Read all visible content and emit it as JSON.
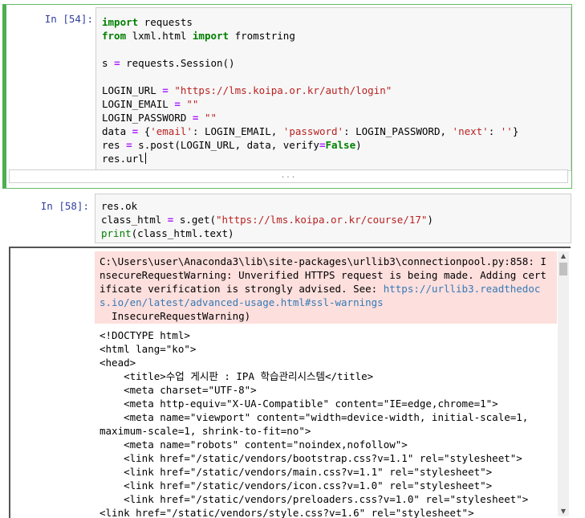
{
  "cell1": {
    "prompt": "In [54]:",
    "lines": [
      [
        "import",
        " requests"
      ],
      [
        "from",
        " lxml.html ",
        "import",
        " fromstring"
      ],
      [
        ""
      ],
      [
        "s ",
        "=",
        " requests.Session()"
      ],
      [
        ""
      ],
      [
        "LOGIN_URL ",
        "=",
        " ",
        "\"https://lms.koipa.or.kr/auth/login\""
      ],
      [
        "LOGIN_EMAIL ",
        "=",
        " ",
        "\"\""
      ],
      [
        "LOGIN_PASSWORD ",
        "=",
        " ",
        "\"\""
      ],
      [
        "data ",
        "=",
        " {",
        "'email'",
        ": LOGIN_EMAIL, ",
        "'password'",
        ": LOGIN_PASSWORD, ",
        "'next'",
        ": ",
        "''",
        "}"
      ],
      [
        "res ",
        "=",
        " s.post(LOGIN_URL, data, verify",
        "=",
        "False",
        ")"
      ],
      [
        "res.url"
      ]
    ],
    "collapsed_output": "..."
  },
  "cell2": {
    "prompt": "In [58]:",
    "line1": "res.ok",
    "line2_a": "class_html ",
    "line2_op": "=",
    "line2_b": " s.get(",
    "line2_str": "\"https://lms.koipa.or.kr/course/17\"",
    "line2_c": ")",
    "line3_fn": "print",
    "line3_b": "(class_html.text)"
  },
  "stderr": {
    "text_before_link": "C:\\Users\\user\\Anaconda3\\lib\\site-packages\\urllib3\\connectionpool.py:858: InsecureRequestWarning: Unverified HTTPS request is being made. Adding certificate verification is strongly advised. See: ",
    "link": "https://urllib3.readthedocs.io/en/latest/advanced-usage.html#ssl-warnings",
    "last_line": "  InsecureRequestWarning)"
  },
  "stdout": {
    "lines": [
      "<!DOCTYPE html>",
      "<html lang=\"ko\">",
      "<head>",
      "    <title>수업 게시판 : IPA 학습관리시스템</title>",
      "    <meta charset=\"UTF-8\">",
      "    <meta http-equiv=\"X-UA-Compatible\" content=\"IE=edge,chrome=1\">",
      "    <meta name=\"viewport\" content=\"width=device-width, initial-scale=1, maximum-scale=1, shrink-to-fit=no\">",
      "    <meta name=\"robots\" content=\"noindex,nofollow\">",
      "    <link href=\"/static/vendors/bootstrap.css?v=1.1\" rel=\"stylesheet\">",
      "    <link href=\"/static/vendors/main.css?v=1.1\" rel=\"stylesheet\">",
      "    <link href=\"/static/vendors/icon.css?v=1.0\" rel=\"stylesheet\">",
      "    <link href=\"/static/vendors/preloaders.css?v=1.0\" rel=\"stylesheet\">    <link href=\"/static/vendors/style.css?v=1.6\" rel=\"stylesheet\">"
    ]
  },
  "scrollbar": {
    "up": "▲",
    "down": "▼"
  }
}
